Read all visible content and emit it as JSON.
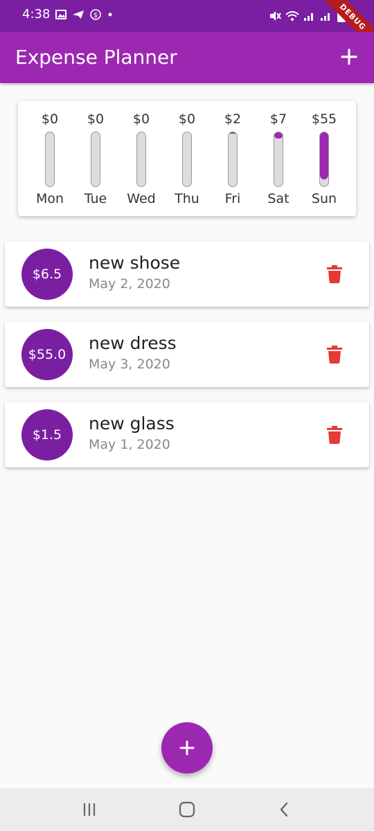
{
  "status_bar": {
    "time": "4:38",
    "debug_label": "DEBUG"
  },
  "app_bar": {
    "title": "Expense Planner",
    "add_icon": "plus-icon"
  },
  "chart": {
    "days": [
      {
        "day": "Mon",
        "amount": "$0",
        "fraction": 0
      },
      {
        "day": "Tue",
        "amount": "$0",
        "fraction": 0
      },
      {
        "day": "Wed",
        "amount": "$0",
        "fraction": 0
      },
      {
        "day": "Thu",
        "amount": "$0",
        "fraction": 0
      },
      {
        "day": "Fri",
        "amount": "$2",
        "fraction": 0.03
      },
      {
        "day": "Sat",
        "amount": "$7",
        "fraction": 0.11
      },
      {
        "day": "Sun",
        "amount": "$55",
        "fraction": 0.87
      }
    ]
  },
  "transactions": [
    {
      "amount": "$6.5",
      "title": "new shose",
      "date": "May 2, 2020"
    },
    {
      "amount": "$55.0",
      "title": "new dress",
      "date": "May 3, 2020"
    },
    {
      "amount": "$1.5",
      "title": "new glass",
      "date": "May 1, 2020"
    }
  ],
  "colors": {
    "primary": "#9c27b0",
    "primary_dark": "#7b1fa2",
    "delete": "#e53935"
  },
  "icons": {
    "delete": "trash-icon",
    "fab": "plus-icon",
    "nav_recent": "recent-apps-icon",
    "nav_home": "home-icon",
    "nav_back": "back-icon"
  }
}
